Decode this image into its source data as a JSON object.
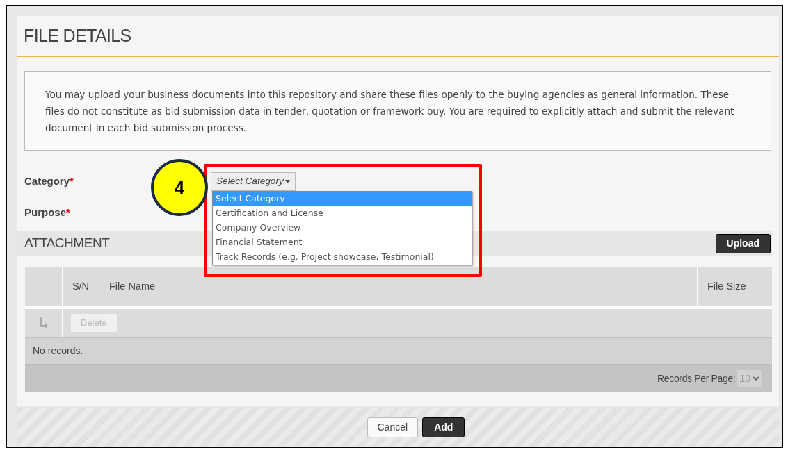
{
  "title": "FILE DETAILS",
  "notice": "You may upload your business documents into this repository and share these files openly to the buying agencies as general information. These files do not constitute as bid submission data in tender, quotation or framework buy. You are required to explicitly attach and submit the relevant document in each bid submission process.",
  "fields": [
    {
      "label": "Category",
      "required_mark": "*"
    },
    {
      "label": "Purpose",
      "required_mark": "*"
    }
  ],
  "category_select": {
    "value": "Select Category",
    "expanded": true,
    "options": [
      {
        "label": "Select Category",
        "selected": true
      },
      {
        "label": "Certification and License",
        "selected": false
      },
      {
        "label": "Company Overview",
        "selected": false
      },
      {
        "label": "Financial Statement",
        "selected": false
      },
      {
        "label": "Track Records (e.g. Project showcase, Testimonial)",
        "selected": false
      }
    ]
  },
  "callout": {
    "number": "4"
  },
  "attachment": {
    "title": "ATTACHMENT",
    "upload_button": "Upload",
    "columns": [
      "S/N",
      "File Name",
      "File Size"
    ],
    "delete_button": {
      "label": "Delete",
      "disabled": true
    },
    "empty_message": "No records.",
    "records_per_page_label": "Records Per Page:",
    "records_per_page_value": "10"
  },
  "buttons": [
    {
      "label": "Cancel",
      "kind": "secondary"
    },
    {
      "label": "Add",
      "kind": "primary"
    }
  ]
}
